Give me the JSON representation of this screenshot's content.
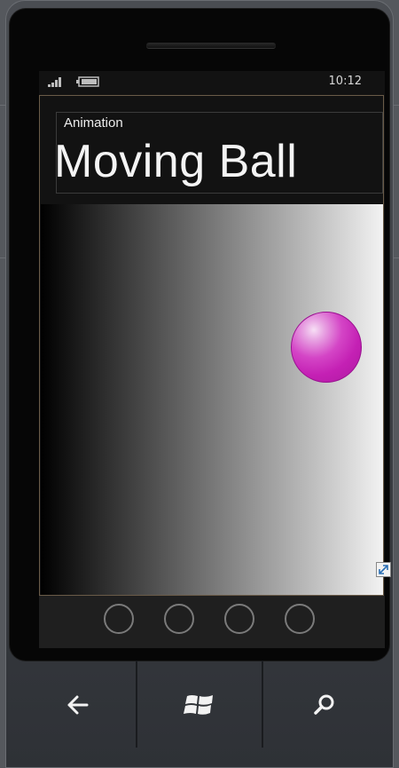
{
  "status_bar": {
    "time": "10:12",
    "signal_icon": "signal-bars-icon",
    "battery_icon": "battery-icon"
  },
  "header": {
    "app_title": "Animation",
    "page_title": "Moving Ball"
  },
  "content": {
    "background": "horizontal gradient black to white",
    "ball_color": "#c420b4"
  },
  "app_bar": {
    "buttons": [
      "app-bar-button-1",
      "app-bar-button-2",
      "app-bar-button-3",
      "app-bar-button-4"
    ]
  },
  "hardware_buttons": {
    "back_icon": "back-arrow-icon",
    "start_icon": "windows-logo-icon",
    "search_icon": "search-icon"
  }
}
